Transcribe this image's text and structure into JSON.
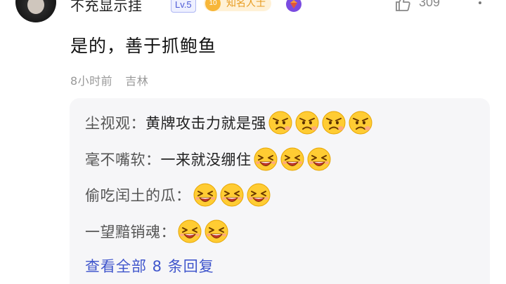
{
  "user": {
    "name": "不充显示挂",
    "level": "Lv.5",
    "fan_level": "10",
    "fan_title": "知名人士"
  },
  "likes": {
    "count": "309"
  },
  "comment": {
    "text": "是的，善于抓鲍鱼",
    "time": "8小时前",
    "location": "吉林"
  },
  "replies": [
    {
      "author": "尘视观：",
      "text": "黄牌攻击力就是强",
      "emoji": "angry-face",
      "emoji_count": 4
    },
    {
      "author": "毫不嘴软：",
      "text": "一来就没绷住",
      "emoji": "laughing-face",
      "emoji_count": 3
    },
    {
      "author": "偷吃闰土的瓜：",
      "text": "",
      "emoji": "laughing-face",
      "emoji_count": 3
    },
    {
      "author": "一望黯销魂：",
      "text": "",
      "emoji": "laughing-face",
      "emoji_count": 2
    }
  ],
  "view_all_label": "查看全部 8 条回复",
  "colors": {
    "link": "#4056cc",
    "badge_gold": "#f7b638",
    "reply_bg": "#f6f6f8"
  }
}
